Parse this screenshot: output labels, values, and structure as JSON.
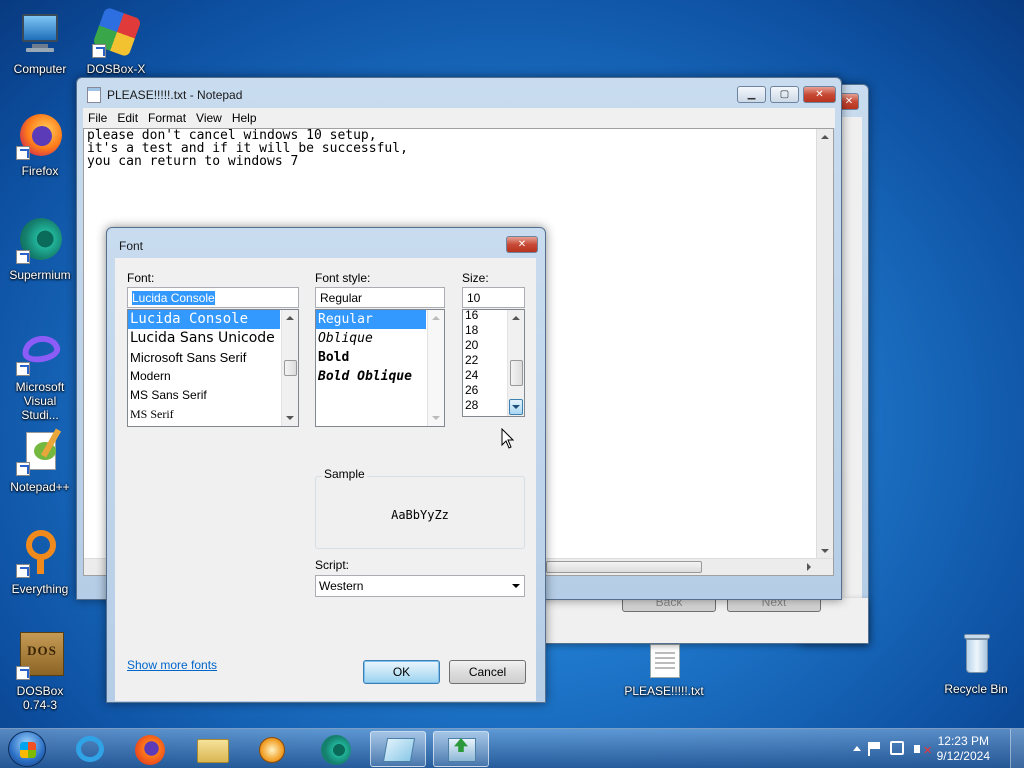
{
  "desktop": {
    "icons": [
      {
        "label": "Computer"
      },
      {
        "label": "DOSBox-X"
      },
      {
        "label": "Firefox"
      },
      {
        "label": "Supermium"
      },
      {
        "label": "Microsoft Visual Studi..."
      },
      {
        "label": "Notepad++"
      },
      {
        "label": "Everything"
      },
      {
        "label": "DOSBox 0.74-3"
      },
      {
        "label": "PLEASE!!!!!.txt"
      },
      {
        "label": "Recycle Bin"
      }
    ],
    "logo_text": "DOS"
  },
  "background_window": {
    "buttons": {
      "back": "Back",
      "next": "Next"
    }
  },
  "notepad": {
    "title": "PLEASE!!!!!.txt - Notepad",
    "menu": [
      "File",
      "Edit",
      "Format",
      "View",
      "Help"
    ],
    "content": "please don't cancel windows 10 setup,\nit's a test and if it will be successful,\nyou can return to windows 7"
  },
  "font_dialog": {
    "title": "Font",
    "font_label": "Font:",
    "font_value": "Lucida Console",
    "fonts": [
      "Lucida Console",
      "Lucida Sans Unicode",
      "Microsoft Sans Serif",
      "Modern",
      "MS Sans Serif",
      "MS Serif"
    ],
    "style_label": "Font style:",
    "style_value": "Regular",
    "styles": [
      "Regular",
      "Oblique",
      "Bold",
      "Bold Oblique"
    ],
    "size_label": "Size:",
    "size_value": "10",
    "sizes": [
      "16",
      "18",
      "20",
      "22",
      "24",
      "26",
      "28"
    ],
    "sample_label": "Sample",
    "sample_text": "AaBbYyZz",
    "script_label": "Script:",
    "script_value": "Western",
    "show_more": "Show more fonts",
    "ok": "OK",
    "cancel": "Cancel"
  },
  "taskbar": {
    "time": "12:23 PM",
    "date": "9/12/2024"
  },
  "colors": {
    "selection": "#3399ff",
    "link": "#0066cc",
    "close_red": "#c74a36"
  }
}
